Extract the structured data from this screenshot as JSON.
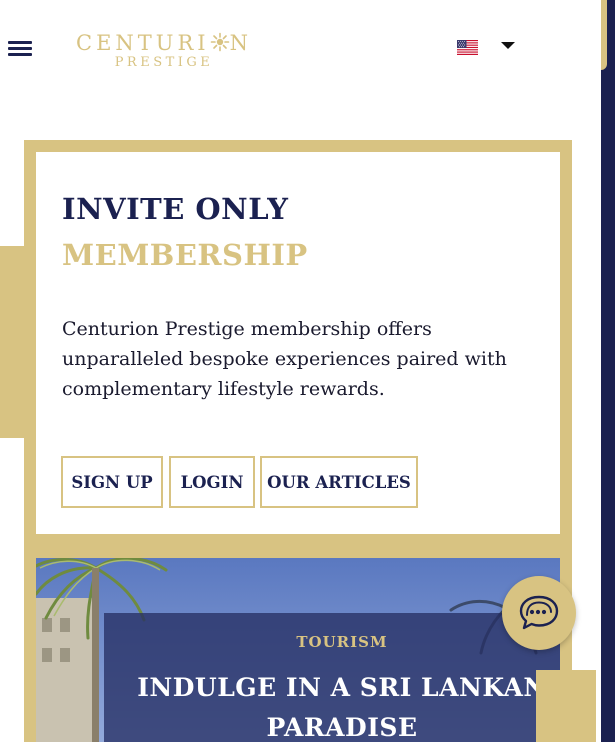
{
  "header": {
    "logo_line1_prefix": "CENTURI",
    "logo_line1_suffix": "N",
    "logo_line2": "PRESTIGE",
    "language": "en-US"
  },
  "hero": {
    "title_line1": "INVITE ONLY",
    "title_line2": "MEMBERSHIP",
    "description": "Centurion Prestige membership offers unparalleled bespoke experiences paired with complementary lifestyle rewards.",
    "buttons": {
      "signup": "SIGN UP",
      "login": "LOGIN",
      "articles": "OUR ARTICLES"
    }
  },
  "article": {
    "category": "TOURISM",
    "headline": "INDULGE IN A SRI LANKAN PARADISE"
  },
  "icons": {
    "menu": "hamburger-menu-icon",
    "flag": "us-flag-icon",
    "dropdown": "caret-down-icon",
    "chat": "chat-bubble-icon"
  },
  "colors": {
    "navy": "#1b2150",
    "gold": "#d8c382",
    "white": "#ffffff"
  }
}
